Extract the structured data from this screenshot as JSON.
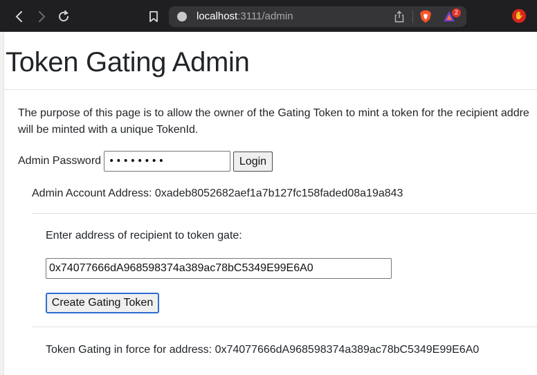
{
  "browser": {
    "url_host": "localhost",
    "url_path": ":3111/admin",
    "rewards_badge": "2",
    "icons": {
      "back": "back-arrow-icon",
      "forward": "forward-arrow-icon",
      "reload": "reload-icon",
      "bookmark": "bookmark-icon",
      "site": "site-info-icon",
      "share": "share-icon",
      "shields": "brave-shields-icon",
      "rewards": "brave-rewards-icon",
      "extension": "stop-hand-extension-icon"
    }
  },
  "page": {
    "title": "Token Gating Admin",
    "purpose_line1": "The purpose of this page is to allow the owner of the Gating Token to mint a token for the recipient addre",
    "purpose_line2": "will be minted with a unique TokenId.",
    "password_label": "Admin Password",
    "password_value": "••••••••",
    "login_label": "Login",
    "admin_account": "Admin Account Address: 0xadeb8052682aef1a7b127fc158faded08a19a843",
    "enter_address_label": "Enter address of recipient to token gate:",
    "recipient_value": "0x74077666dA968598374a389ac78bC5349E99E6A0",
    "create_button_label": "Create Gating Token",
    "gating_status": "Token Gating in force for address: 0x74077666dA968598374a389ac78bC5349E99E6A0"
  }
}
